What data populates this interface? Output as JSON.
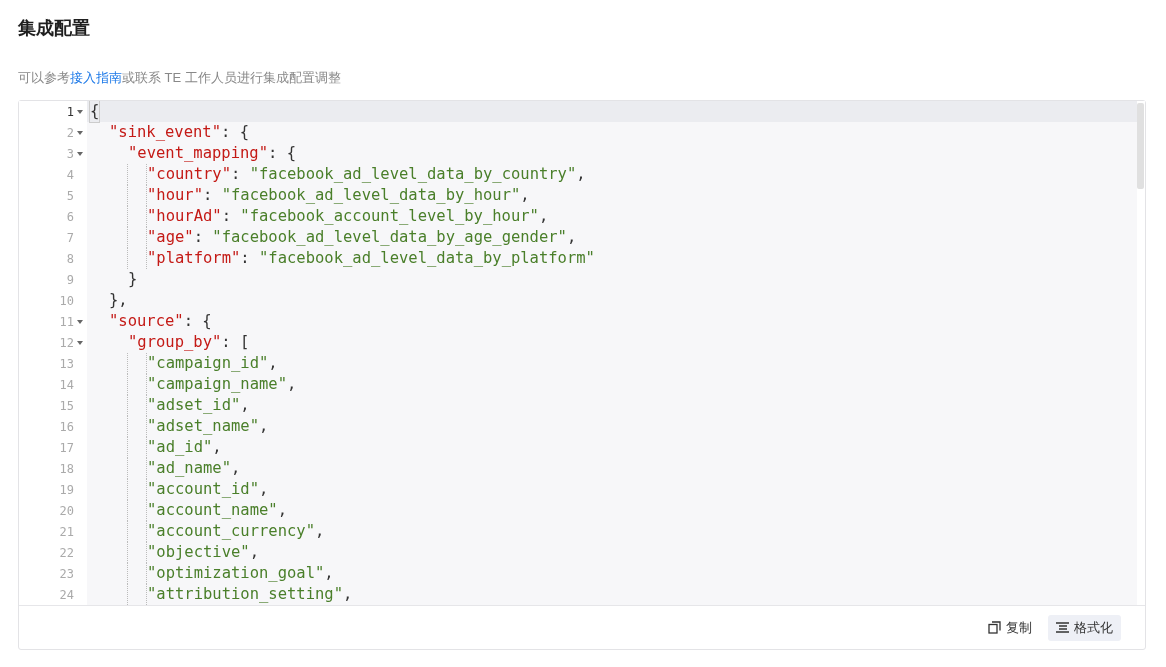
{
  "title": "集成配置",
  "description": {
    "before": "可以参考",
    "link": "接入指南",
    "after": "或联系 TE 工作人员进行集成配置调整"
  },
  "editor": {
    "lines": [
      {
        "number": "1",
        "foldable": true,
        "active": true,
        "tokens": [
          {
            "kind": "punct",
            "text": "{"
          }
        ]
      },
      {
        "number": "2",
        "foldable": true,
        "active": false,
        "tokens": [
          {
            "kind": "key",
            "text": "\"sink_event\""
          },
          {
            "kind": "punct",
            "text": ": {"
          }
        ]
      },
      {
        "number": "3",
        "foldable": true,
        "active": false,
        "tokens": [
          {
            "kind": "key",
            "text": "\"event_mapping\""
          },
          {
            "kind": "punct",
            "text": ": {"
          }
        ]
      },
      {
        "number": "4",
        "foldable": false,
        "active": false,
        "tokens": [
          {
            "kind": "key",
            "text": "\"country\""
          },
          {
            "kind": "punct",
            "text": ": "
          },
          {
            "kind": "string",
            "text": "\"facebook_ad_level_data_by_country\""
          },
          {
            "kind": "punct",
            "text": ","
          }
        ]
      },
      {
        "number": "5",
        "foldable": false,
        "active": false,
        "tokens": [
          {
            "kind": "key",
            "text": "\"hour\""
          },
          {
            "kind": "punct",
            "text": ": "
          },
          {
            "kind": "string",
            "text": "\"facebook_ad_level_data_by_hour\""
          },
          {
            "kind": "punct",
            "text": ","
          }
        ]
      },
      {
        "number": "6",
        "foldable": false,
        "active": false,
        "tokens": [
          {
            "kind": "key",
            "text": "\"hourAd\""
          },
          {
            "kind": "punct",
            "text": ": "
          },
          {
            "kind": "string",
            "text": "\"facebook_account_level_by_hour\""
          },
          {
            "kind": "punct",
            "text": ","
          }
        ]
      },
      {
        "number": "7",
        "foldable": false,
        "active": false,
        "tokens": [
          {
            "kind": "key",
            "text": "\"age\""
          },
          {
            "kind": "punct",
            "text": ": "
          },
          {
            "kind": "string",
            "text": "\"facebook_ad_level_data_by_age_gender\""
          },
          {
            "kind": "punct",
            "text": ","
          }
        ]
      },
      {
        "number": "8",
        "foldable": false,
        "active": false,
        "tokens": [
          {
            "kind": "key",
            "text": "\"platform\""
          },
          {
            "kind": "punct",
            "text": ": "
          },
          {
            "kind": "string",
            "text": "\"facebook_ad_level_data_by_platform\""
          }
        ]
      },
      {
        "number": "9",
        "foldable": false,
        "active": false,
        "tokens": [
          {
            "kind": "punct",
            "text": "}"
          }
        ]
      },
      {
        "number": "10",
        "foldable": false,
        "active": false,
        "tokens": [
          {
            "kind": "punct",
            "text": "},"
          }
        ]
      },
      {
        "number": "11",
        "foldable": true,
        "active": false,
        "tokens": [
          {
            "kind": "key",
            "text": "\"source\""
          },
          {
            "kind": "punct",
            "text": ": {"
          }
        ]
      },
      {
        "number": "12",
        "foldable": true,
        "active": false,
        "tokens": [
          {
            "kind": "key",
            "text": "\"group_by\""
          },
          {
            "kind": "punct",
            "text": ": ["
          }
        ]
      },
      {
        "number": "13",
        "foldable": false,
        "active": false,
        "tokens": [
          {
            "kind": "string",
            "text": "\"campaign_id\""
          },
          {
            "kind": "punct",
            "text": ","
          }
        ]
      },
      {
        "number": "14",
        "foldable": false,
        "active": false,
        "tokens": [
          {
            "kind": "string",
            "text": "\"campaign_name\""
          },
          {
            "kind": "punct",
            "text": ","
          }
        ]
      },
      {
        "number": "15",
        "foldable": false,
        "active": false,
        "tokens": [
          {
            "kind": "string",
            "text": "\"adset_id\""
          },
          {
            "kind": "punct",
            "text": ","
          }
        ]
      },
      {
        "number": "16",
        "foldable": false,
        "active": false,
        "tokens": [
          {
            "kind": "string",
            "text": "\"adset_name\""
          },
          {
            "kind": "punct",
            "text": ","
          }
        ]
      },
      {
        "number": "17",
        "foldable": false,
        "active": false,
        "tokens": [
          {
            "kind": "string",
            "text": "\"ad_id\""
          },
          {
            "kind": "punct",
            "text": ","
          }
        ]
      },
      {
        "number": "18",
        "foldable": false,
        "active": false,
        "tokens": [
          {
            "kind": "string",
            "text": "\"ad_name\""
          },
          {
            "kind": "punct",
            "text": ","
          }
        ]
      },
      {
        "number": "19",
        "foldable": false,
        "active": false,
        "tokens": [
          {
            "kind": "string",
            "text": "\"account_id\""
          },
          {
            "kind": "punct",
            "text": ","
          }
        ]
      },
      {
        "number": "20",
        "foldable": false,
        "active": false,
        "tokens": [
          {
            "kind": "string",
            "text": "\"account_name\""
          },
          {
            "kind": "punct",
            "text": ","
          }
        ]
      },
      {
        "number": "21",
        "foldable": false,
        "active": false,
        "tokens": [
          {
            "kind": "string",
            "text": "\"account_currency\""
          },
          {
            "kind": "punct",
            "text": ","
          }
        ]
      },
      {
        "number": "22",
        "foldable": false,
        "active": false,
        "tokens": [
          {
            "kind": "string",
            "text": "\"objective\""
          },
          {
            "kind": "punct",
            "text": ","
          }
        ]
      },
      {
        "number": "23",
        "foldable": false,
        "active": false,
        "tokens": [
          {
            "kind": "string",
            "text": "\"optimization_goal\""
          },
          {
            "kind": "punct",
            "text": ","
          }
        ]
      },
      {
        "number": "24",
        "foldable": false,
        "active": false,
        "tokens": [
          {
            "kind": "string",
            "text": "\"attribution_setting\""
          },
          {
            "kind": "punct",
            "text": ","
          }
        ]
      }
    ]
  },
  "actions": [
    {
      "kind": "copy",
      "label": "复制",
      "selected": false
    },
    {
      "kind": "format",
      "label": "格式化",
      "selected": true
    }
  ]
}
